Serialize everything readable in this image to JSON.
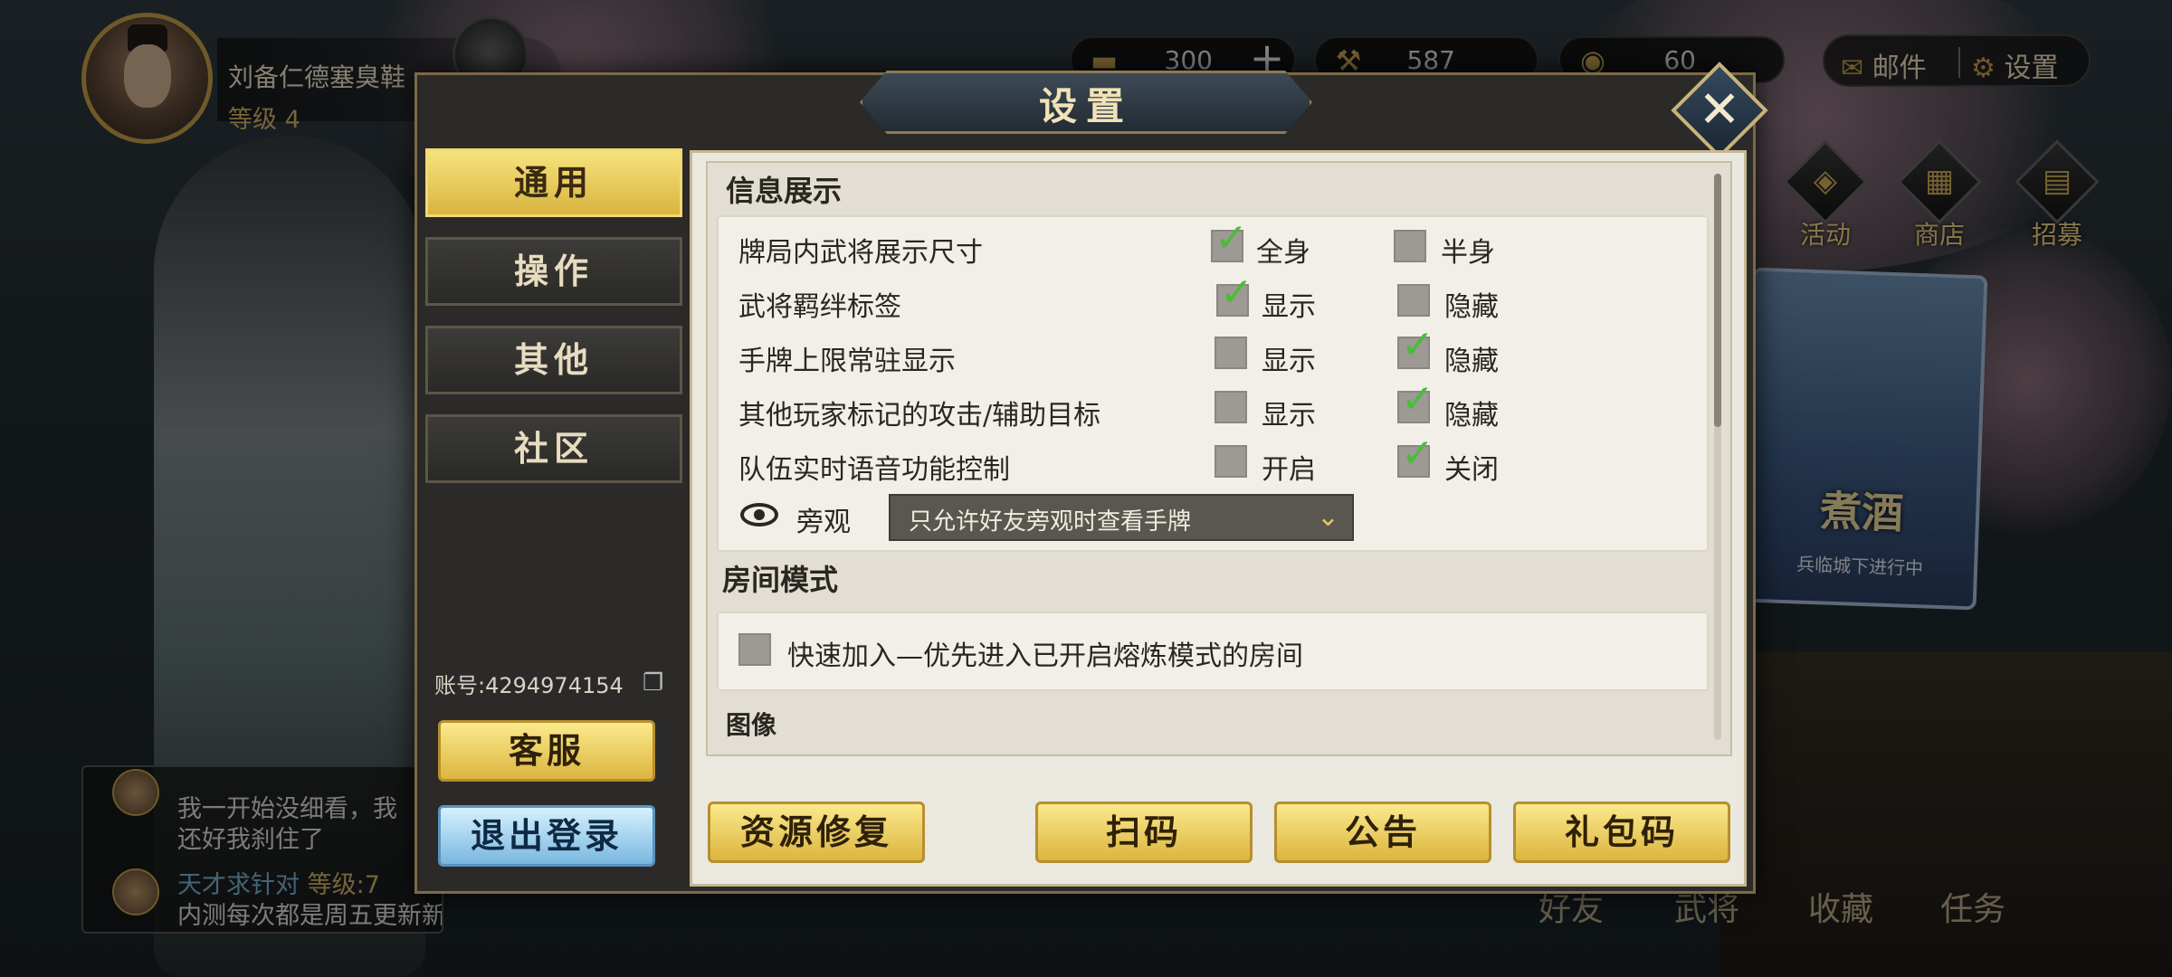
{
  "profile": {
    "name": "刘备仁德塞臭鞋",
    "level": "等级 4"
  },
  "resources": [
    {
      "icon": "gold-ingot-icon",
      "glyph": "▬",
      "value": "300"
    },
    {
      "icon": "hammer-icon",
      "glyph": "⚒",
      "value": "587"
    },
    {
      "icon": "coin-icon",
      "glyph": "◉",
      "value": "60"
    }
  ],
  "top_menu": {
    "mail": "邮件",
    "settings": "设置"
  },
  "side_icons": [
    {
      "label": "活动",
      "glyph": "◈"
    },
    {
      "label": "商店",
      "glyph": "▦"
    },
    {
      "label": "招募",
      "glyph": "▤"
    }
  ],
  "event_card": {
    "title": "煮酒",
    "subtitle": "兵临城下进行中"
  },
  "chat": {
    "line1a": "我一开始没细看，我",
    "line1b": "还好我刹住了",
    "line2_name": "天才求针对",
    "line2_level": "等级:7",
    "line2_msg": "内测每次都是周五更新新武将"
  },
  "bottom_nav": [
    "好友",
    "武将",
    "收藏",
    "任务"
  ],
  "dialog": {
    "title": "设置",
    "close_glyph": "✕",
    "tabs": [
      "通用",
      "操作",
      "其他",
      "社区"
    ],
    "active_tab": "通用",
    "account": "账号:4294974154",
    "service_btn": "客服",
    "logout_btn": "退出登录",
    "info_section": "信息展示",
    "rows": [
      {
        "label": "牌局内武将展示尺寸",
        "opt1": "全身",
        "opt1_checked": true,
        "opt2": "半身",
        "opt2_checked": false
      },
      {
        "label": "武将羁绊标签",
        "opt1": "显示",
        "opt1_checked": true,
        "opt2": "隐藏",
        "opt2_checked": false
      },
      {
        "label": "手牌上限常驻显示",
        "opt1": "显示",
        "opt1_checked": false,
        "opt2": "隐藏",
        "opt2_checked": true
      },
      {
        "label": "其他玩家标记的攻击/辅助目标",
        "opt1": "显示",
        "opt1_checked": false,
        "opt2": "隐藏",
        "opt2_checked": true
      },
      {
        "label": "队伍实时语音功能控制",
        "opt1": "开启",
        "opt1_checked": false,
        "opt2": "关闭",
        "opt2_checked": true
      }
    ],
    "spectate_label": "旁观",
    "spectate_value": "只允许好友旁观时查看手牌",
    "room_section": "房间模式",
    "quick_join": "快速加入—优先进入已开启熔炼模式的房间",
    "image_section": "图像",
    "buttons": {
      "repair": "资源修复",
      "scan": "扫码",
      "notice": "公告",
      "gift": "礼包码"
    }
  },
  "colors": {
    "gold": "#dcb53f",
    "check_green": "#4dbb3a",
    "panel_bg": "#ebe8e0"
  }
}
